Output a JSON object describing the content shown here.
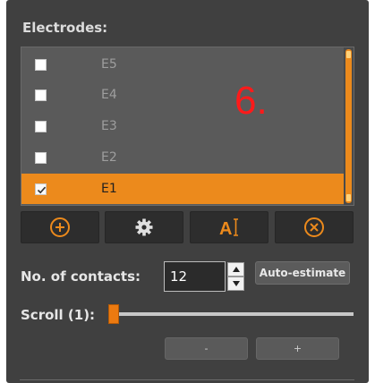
{
  "electrodes": {
    "title": "Electrodes:",
    "items": [
      {
        "label": "E5",
        "checked": false,
        "selected": false
      },
      {
        "label": "E4",
        "checked": false,
        "selected": false
      },
      {
        "label": "E3",
        "checked": false,
        "selected": false
      },
      {
        "label": "E2",
        "checked": false,
        "selected": false
      },
      {
        "label": "E1",
        "checked": true,
        "selected": true
      }
    ]
  },
  "annotation": "6.",
  "toolbar": {
    "add_icon": "plus-circle-icon",
    "settings_icon": "gear-icon",
    "rename_icon": "text-cursor-icon",
    "delete_icon": "x-circle-icon",
    "rename_glyph": "A"
  },
  "contacts": {
    "label": "No. of contacts:",
    "value": "12",
    "auto_estimate_label": "Auto-estimate"
  },
  "scroll": {
    "label": "Scroll (1):",
    "value": 0
  },
  "buttons": {
    "minus_label": "-",
    "plus_label": "+"
  },
  "colors": {
    "accent": "#ec8a1c",
    "panel_bg": "#404040",
    "annotation": "#ff1a1a"
  }
}
